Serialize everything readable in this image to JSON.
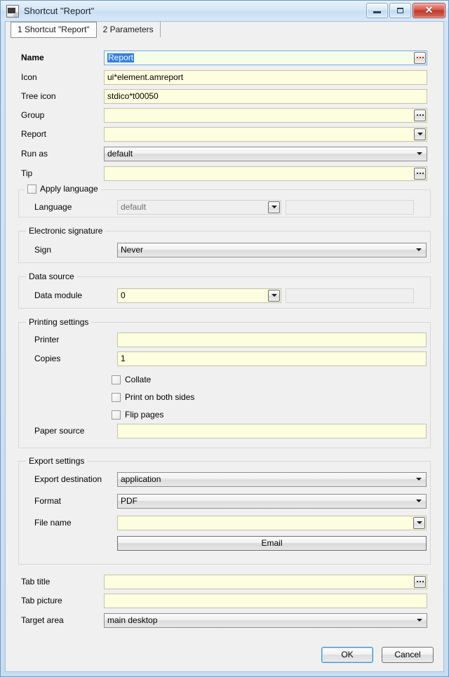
{
  "window": {
    "title": "Shortcut \"Report\"",
    "icon": "app-window-icon",
    "minimize_label": "Minimize",
    "maximize_label": "Maximize",
    "close_label": "✕"
  },
  "tabs": [
    {
      "label": "1 Shortcut \"Report\"",
      "active": true
    },
    {
      "label": "2 Parameters",
      "active": false
    }
  ],
  "fields": {
    "name": {
      "label": "Name",
      "value": "Report",
      "selected_text": "Report",
      "button": "ellipsis-red"
    },
    "icon": {
      "label": "Icon",
      "value": "ui*element.amreport"
    },
    "tree_icon": {
      "label": "Tree icon",
      "value": "stdico*t00050"
    },
    "group": {
      "label": "Group",
      "value": "",
      "button": "ellipsis"
    },
    "report": {
      "label": "Report",
      "value": "",
      "button": "dropdown"
    },
    "run_as": {
      "label": "Run as",
      "value": "default"
    },
    "tip": {
      "label": "Tip",
      "value": "",
      "button": "ellipsis"
    }
  },
  "language_group": {
    "checkbox_label": "Apply language",
    "checked": false,
    "language": {
      "label": "Language",
      "value": "default"
    }
  },
  "signature_group": {
    "title": "Electronic signature",
    "sign": {
      "label": "Sign",
      "value": "Never"
    }
  },
  "datasource_group": {
    "title": "Data source",
    "data_module": {
      "label": "Data module",
      "value": "0"
    }
  },
  "printing_group": {
    "title": "Printing settings",
    "printer": {
      "label": "Printer",
      "value": ""
    },
    "copies": {
      "label": "Copies",
      "value": "1"
    },
    "checkboxes": [
      {
        "label": "Collate",
        "checked": false
      },
      {
        "label": "Print on both sides",
        "checked": false
      },
      {
        "label": "Flip pages",
        "checked": false
      }
    ],
    "paper_source": {
      "label": "Paper source",
      "value": ""
    }
  },
  "export_group": {
    "title": "Export settings",
    "destination": {
      "label": "Export destination",
      "value": "application"
    },
    "format": {
      "label": "Format",
      "value": "PDF"
    },
    "file_name": {
      "label": "File name",
      "value": ""
    },
    "email_button": "Email"
  },
  "bottom": {
    "tab_title": {
      "label": "Tab title",
      "value": ""
    },
    "tab_picture": {
      "label": "Tab picture",
      "value": ""
    },
    "target_area": {
      "label": "Target area",
      "value": "main desktop"
    }
  },
  "footer": {
    "ok": "OK",
    "cancel": "Cancel"
  },
  "colors": {
    "field_yellow": "#fdfddf",
    "selection_blue": "#2f7fe0",
    "close_red": "#b93b2f",
    "accent_blue": "#3c93d8"
  }
}
